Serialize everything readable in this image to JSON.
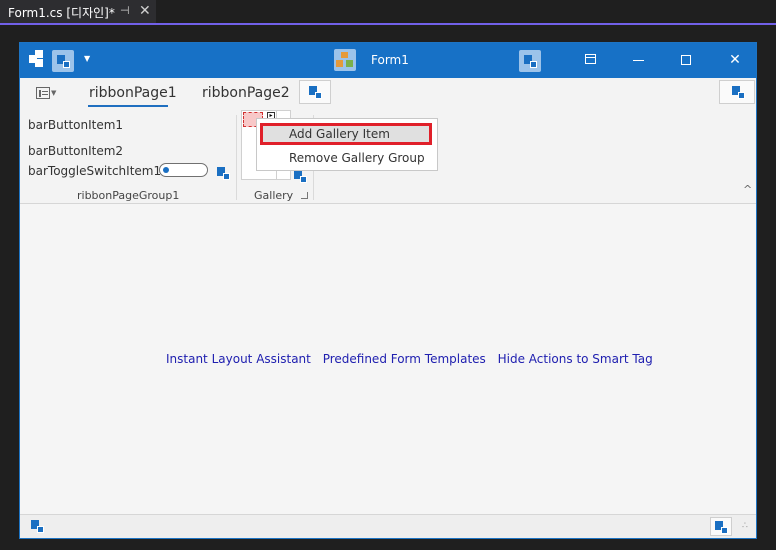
{
  "tab": {
    "label": "Form1.cs [디자인]*",
    "pin_icon": "pin-icon",
    "close_icon": "close-icon"
  },
  "form": {
    "title": "Form1",
    "buttons": [
      "minimize-icon",
      "maximize-icon",
      "close-icon"
    ]
  },
  "ribbon": {
    "tabs": [
      {
        "label": "ribbonPage1",
        "selected": true
      },
      {
        "label": "ribbonPage2",
        "selected": false
      }
    ],
    "group1": {
      "items": [
        "barButtonItem1",
        "barButtonItem2",
        "barToggleSwitchItem1"
      ],
      "caption": "ribbonPageGroup1"
    },
    "gallery": {
      "caption": "Gallery"
    },
    "collapse_glyph": "^"
  },
  "context_menu": {
    "items": [
      {
        "label": "Add Gallery Item",
        "highlighted": true
      },
      {
        "label": "Remove Gallery Group",
        "highlighted": false
      }
    ]
  },
  "designer": {
    "links": [
      "Instant Layout Assistant",
      "Predefined Form Templates",
      "Hide Actions to Smart Tag"
    ]
  },
  "colors": {
    "titlebar": "#1771c6",
    "accent_tab": "#7160e8",
    "highlight": "#e0202a",
    "link": "#2020b0"
  }
}
